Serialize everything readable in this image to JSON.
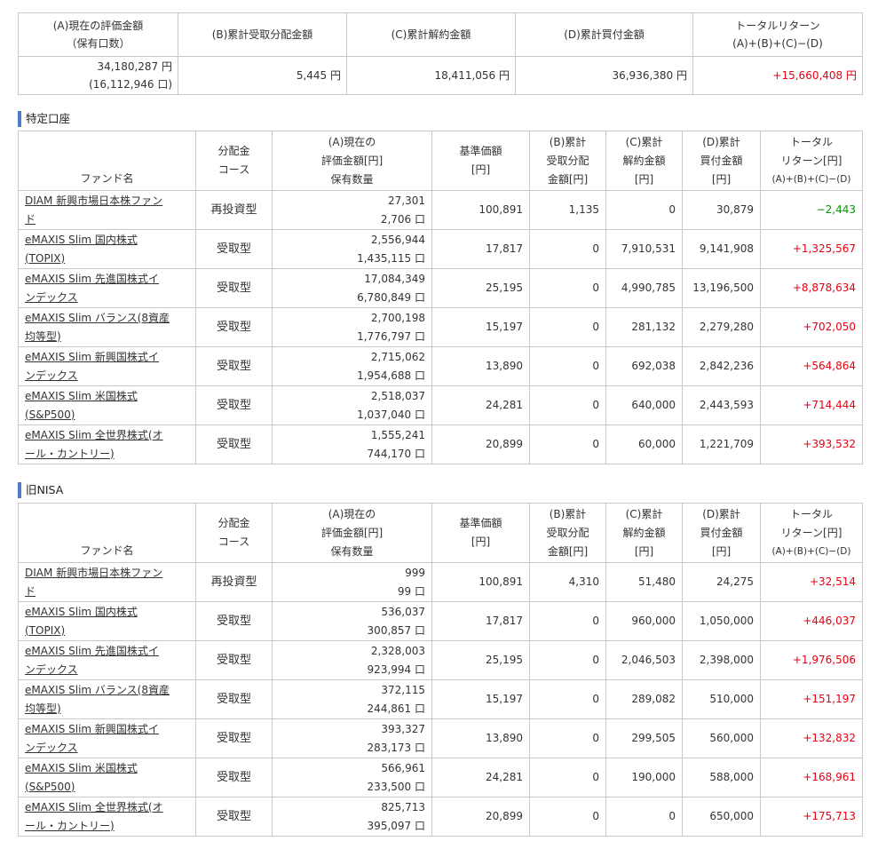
{
  "summary": {
    "headers": [
      [
        "(A)現在の評価金額",
        "（保有口数）"
      ],
      [
        "(B)累計受取分配金額"
      ],
      [
        "(C)累計解約金額"
      ],
      [
        "(D)累計買付金額"
      ],
      [
        "トータルリターン",
        "(A)+(B)+(C)−(D)"
      ]
    ],
    "values": {
      "valuation": "34,180,287 円",
      "units": "(16,112,946 口)",
      "dividends": "5,445 円",
      "cancellation": "18,411,056 円",
      "purchase": "36,936,380 円",
      "total_return": "+15,660,408 円"
    }
  },
  "column_headers": {
    "fund_name": "ファンド名",
    "course": [
      "分配金",
      "コース"
    ],
    "valuation": [
      "(A)現在の",
      "評価金額[円]",
      "保有数量"
    ],
    "nav": [
      "基準価額",
      "[円]"
    ],
    "dividends": [
      "(B)累計",
      "受取分配",
      "金額[円]"
    ],
    "cancellation": [
      "(C)累計",
      "解約金額",
      "[円]"
    ],
    "purchase": [
      "(D)累計",
      "買付金額",
      "[円]"
    ],
    "total_return": [
      "トータル",
      "リターン[円]",
      "(A)+(B)+(C)−(D)"
    ]
  },
  "sections": [
    {
      "title": "特定口座",
      "rows": [
        {
          "name": [
            "DIAM 新興市場日本株ファン",
            "ド"
          ],
          "course": "再投資型",
          "valuation": "27,301",
          "quantity": "2,706 口",
          "nav": "100,891",
          "dividends": "1,135",
          "cancellation": "0",
          "purchase": "30,879",
          "total_return": "−2,443",
          "sign": "neg"
        },
        {
          "name": [
            "eMAXIS Slim 国内株式",
            "(TOPIX)"
          ],
          "course": "受取型",
          "valuation": "2,556,944",
          "quantity": "1,435,115 口",
          "nav": "17,817",
          "dividends": "0",
          "cancellation": "7,910,531",
          "purchase": "9,141,908",
          "total_return": "+1,325,567",
          "sign": "pos"
        },
        {
          "name": [
            "eMAXIS Slim 先進国株式イ",
            "ンデックス"
          ],
          "course": "受取型",
          "valuation": "17,084,349",
          "quantity": "6,780,849 口",
          "nav": "25,195",
          "dividends": "0",
          "cancellation": "4,990,785",
          "purchase": "13,196,500",
          "total_return": "+8,878,634",
          "sign": "pos"
        },
        {
          "name": [
            "eMAXIS Slim バランス(8資産",
            "均等型)"
          ],
          "course": "受取型",
          "valuation": "2,700,198",
          "quantity": "1,776,797 口",
          "nav": "15,197",
          "dividends": "0",
          "cancellation": "281,132",
          "purchase": "2,279,280",
          "total_return": "+702,050",
          "sign": "pos"
        },
        {
          "name": [
            "eMAXIS Slim 新興国株式イ",
            "ンデックス"
          ],
          "course": "受取型",
          "valuation": "2,715,062",
          "quantity": "1,954,688 口",
          "nav": "13,890",
          "dividends": "0",
          "cancellation": "692,038",
          "purchase": "2,842,236",
          "total_return": "+564,864",
          "sign": "pos"
        },
        {
          "name": [
            "eMAXIS Slim 米国株式",
            "(S&P500)"
          ],
          "course": "受取型",
          "valuation": "2,518,037",
          "quantity": "1,037,040 口",
          "nav": "24,281",
          "dividends": "0",
          "cancellation": "640,000",
          "purchase": "2,443,593",
          "total_return": "+714,444",
          "sign": "pos"
        },
        {
          "name": [
            "eMAXIS Slim 全世界株式(オ",
            "ール・カントリー)"
          ],
          "course": "受取型",
          "valuation": "1,555,241",
          "quantity": "744,170 口",
          "nav": "20,899",
          "dividends": "0",
          "cancellation": "60,000",
          "purchase": "1,221,709",
          "total_return": "+393,532",
          "sign": "pos"
        }
      ]
    },
    {
      "title": "旧NISA",
      "rows": [
        {
          "name": [
            "DIAM 新興市場日本株ファン",
            "ド"
          ],
          "course": "再投資型",
          "valuation": "999",
          "quantity": "99 口",
          "nav": "100,891",
          "dividends": "4,310",
          "cancellation": "51,480",
          "purchase": "24,275",
          "total_return": "+32,514",
          "sign": "pos"
        },
        {
          "name": [
            "eMAXIS Slim 国内株式",
            "(TOPIX)"
          ],
          "course": "受取型",
          "valuation": "536,037",
          "quantity": "300,857 口",
          "nav": "17,817",
          "dividends": "0",
          "cancellation": "960,000",
          "purchase": "1,050,000",
          "total_return": "+446,037",
          "sign": "pos"
        },
        {
          "name": [
            "eMAXIS Slim 先進国株式イ",
            "ンデックス"
          ],
          "course": "受取型",
          "valuation": "2,328,003",
          "quantity": "923,994 口",
          "nav": "25,195",
          "dividends": "0",
          "cancellation": "2,046,503",
          "purchase": "2,398,000",
          "total_return": "+1,976,506",
          "sign": "pos"
        },
        {
          "name": [
            "eMAXIS Slim バランス(8資産",
            "均等型)"
          ],
          "course": "受取型",
          "valuation": "372,115",
          "quantity": "244,861 口",
          "nav": "15,197",
          "dividends": "0",
          "cancellation": "289,082",
          "purchase": "510,000",
          "total_return": "+151,197",
          "sign": "pos"
        },
        {
          "name": [
            "eMAXIS Slim 新興国株式イ",
            "ンデックス"
          ],
          "course": "受取型",
          "valuation": "393,327",
          "quantity": "283,173 口",
          "nav": "13,890",
          "dividends": "0",
          "cancellation": "299,505",
          "purchase": "560,000",
          "total_return": "+132,832",
          "sign": "pos"
        },
        {
          "name": [
            "eMAXIS Slim 米国株式",
            "(S&P500)"
          ],
          "course": "受取型",
          "valuation": "566,961",
          "quantity": "233,500 口",
          "nav": "24,281",
          "dividends": "0",
          "cancellation": "190,000",
          "purchase": "588,000",
          "total_return": "+168,961",
          "sign": "pos"
        },
        {
          "name": [
            "eMAXIS Slim 全世界株式(オ",
            "ール・カントリー)"
          ],
          "course": "受取型",
          "valuation": "825,713",
          "quantity": "395,097 口",
          "nav": "20,899",
          "dividends": "0",
          "cancellation": "0",
          "purchase": "650,000",
          "total_return": "+175,713",
          "sign": "pos"
        }
      ]
    }
  ],
  "colors": {
    "positive": "#e60012",
    "negative": "#009900",
    "accent": "#4a7cc7",
    "border": "#c8c8c8"
  }
}
